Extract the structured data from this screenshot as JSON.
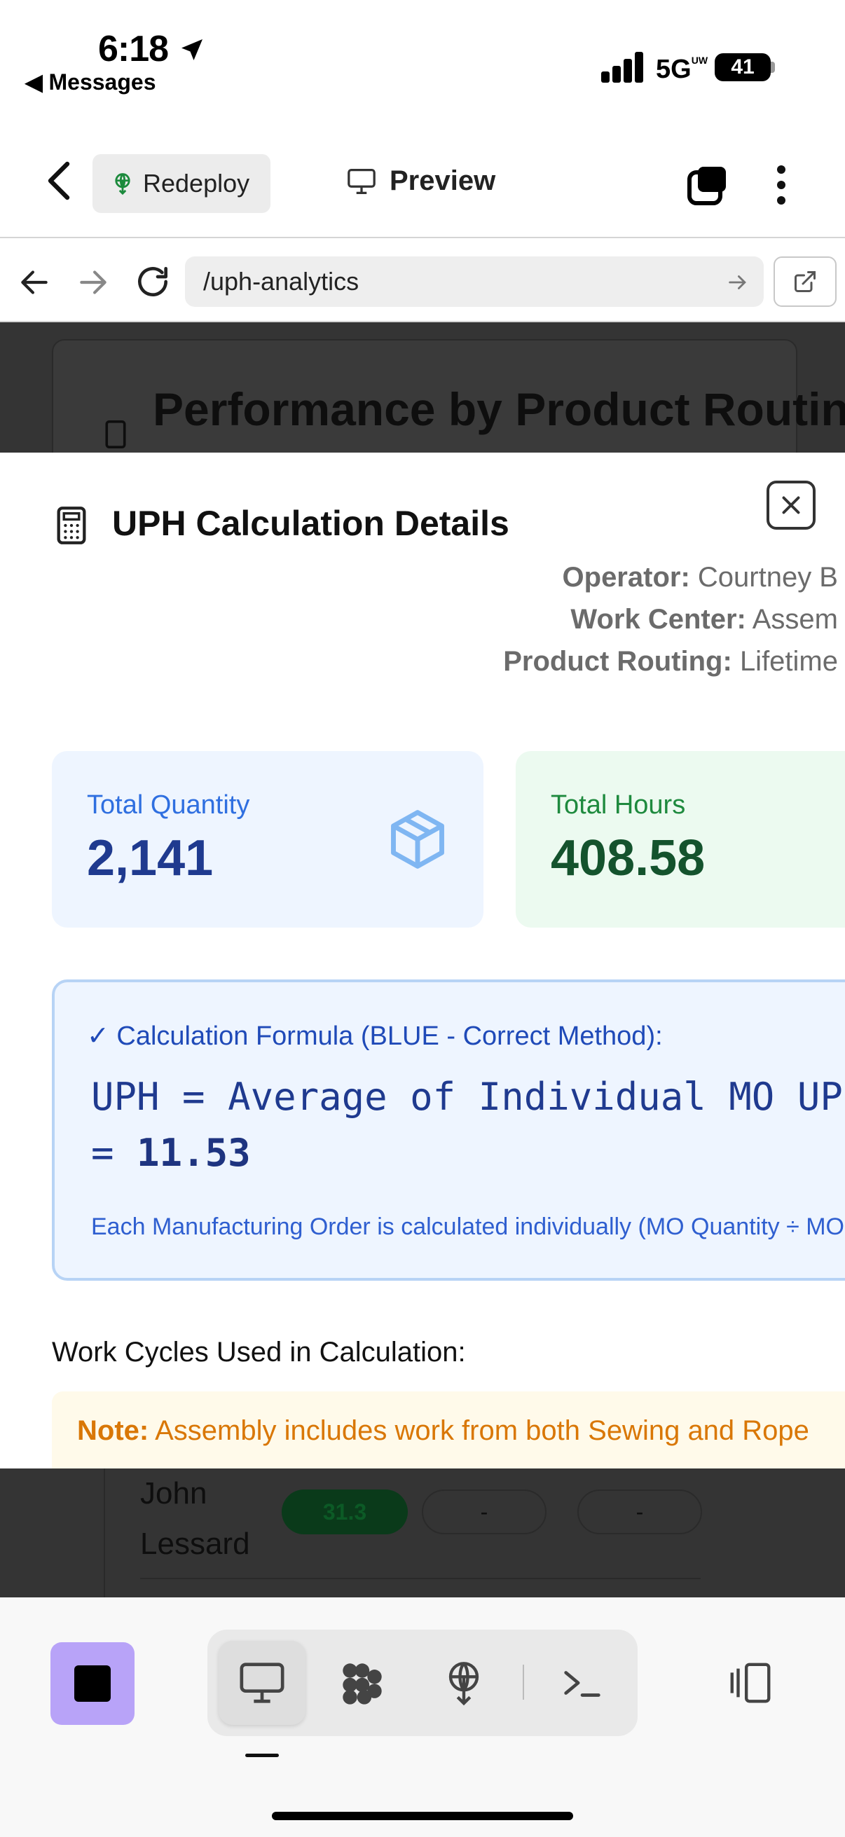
{
  "status_bar": {
    "time": "6:18",
    "back_app": "◀ Messages",
    "network": "5G",
    "network_sup": "UW",
    "battery": "41"
  },
  "toolbar": {
    "redeploy_label": "Redeploy",
    "preview_label": "Preview"
  },
  "url_bar": {
    "path": "/uph-analytics"
  },
  "background_page": {
    "card_title": "Performance by Product Routing",
    "row_name": "John Lessard",
    "pill_value": "31.3",
    "pill_empty_1": "-",
    "pill_empty_2": "-"
  },
  "modal": {
    "title": "UPH Calculation Details",
    "meta": [
      {
        "label": "Operator:",
        "value": "Courtney B"
      },
      {
        "label": "Work Center:",
        "value": "Assem"
      },
      {
        "label": "Product Routing:",
        "value": "Lifetime"
      }
    ],
    "stats": {
      "total_quantity": {
        "label": "Total Quantity",
        "value": "2,141"
      },
      "total_hours": {
        "label": "Total Hours",
        "value": "408.58"
      }
    },
    "formula": {
      "heading": "✓ Calculation Formula (BLUE - Correct Method):",
      "line1": "UPH = Average of Individual MO UPH",
      "line2_prefix": "=",
      "line2_value": "11.53",
      "note": "Each Manufacturing Order is calculated individually (MO Quantity ÷ MO Hours)"
    },
    "cycles_title": "Work Cycles Used in Calculation:",
    "note": {
      "label": "Note:",
      "text": "Assembly includes work from both Sewing and Rope"
    }
  },
  "colors": {
    "accent_blue": "#1f4ab8",
    "green_dark": "#14532d",
    "note_orange": "#d97706",
    "stop_purple": "#b8a3f8"
  },
  "bottom_bar": {
    "icons": [
      "stop-icon",
      "desktop-icon",
      "cluster-icon",
      "deploy-icon",
      "terminal-icon",
      "split-view-icon"
    ]
  }
}
